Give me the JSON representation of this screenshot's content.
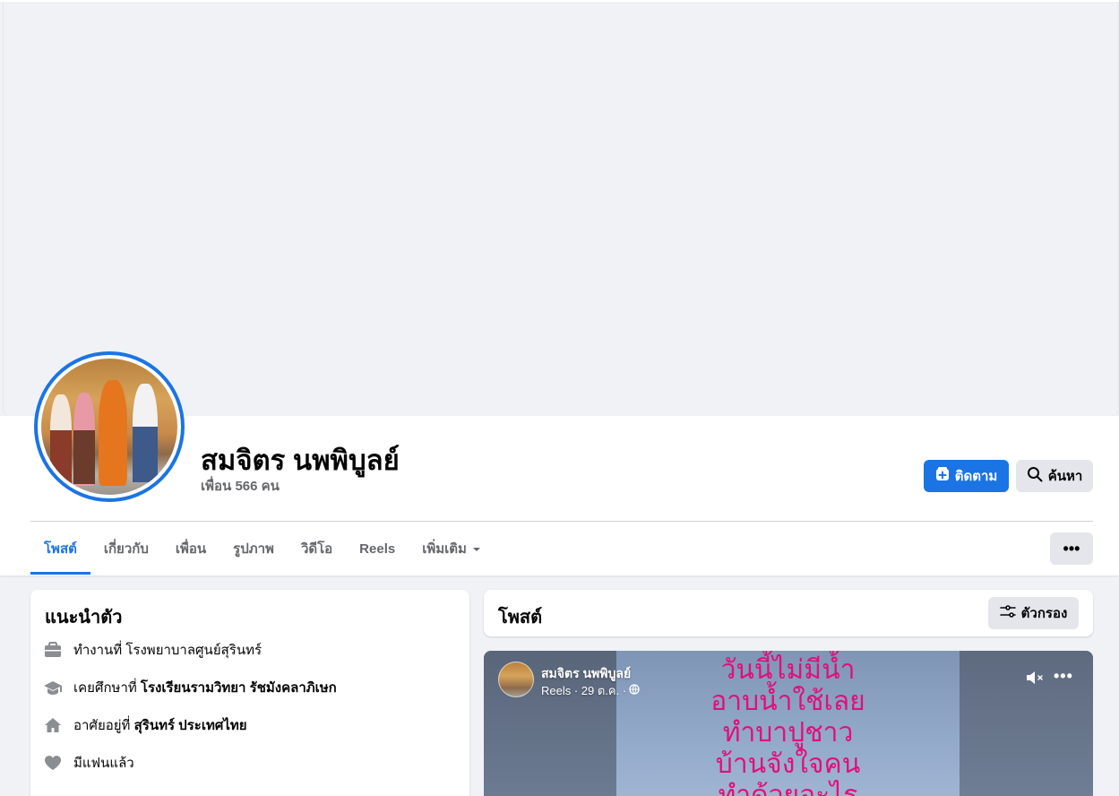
{
  "profile": {
    "name": "สมจิตร นพพิบูลย์",
    "friends_text": "เพื่อน 566 คน"
  },
  "actions": {
    "follow_label": "ติดตาม",
    "search_label": "ค้นหา",
    "more_label": "•••"
  },
  "tabs": [
    {
      "label": "โพสต์",
      "active": true
    },
    {
      "label": "เกี่ยวกับ"
    },
    {
      "label": "เพื่อน"
    },
    {
      "label": "รูปภาพ"
    },
    {
      "label": "วิดีโอ"
    },
    {
      "label": "Reels"
    },
    {
      "label": "เพิ่มเติม"
    }
  ],
  "intro": {
    "title": "แนะนำตัว",
    "items": [
      {
        "icon": "briefcase-icon",
        "prefix": "ทำงานที่ โรงพยาบาลศูนย์สุรินทร์",
        "bold": ""
      },
      {
        "icon": "graduation-cap-icon",
        "prefix": "เคยศึกษาที่ ",
        "bold": "โรงเรียนรามวิทยา รัชมังคลาภิเษก"
      },
      {
        "icon": "home-icon",
        "prefix": "อาศัยอยู่ที่ ",
        "bold": "สุรินทร์ ประเทศไทย"
      },
      {
        "icon": "heart-icon",
        "prefix": "มีแฟนแล้ว",
        "bold": ""
      }
    ]
  },
  "posts": {
    "title": "โพสต์",
    "filter_label": "ตัวกรอง"
  },
  "reel": {
    "author": "สมจิตร นพพิบูลย์",
    "meta": "Reels · 29 ต.ค. ·",
    "caption_lines": [
      "วันนี้ไม่มีน้ำ",
      "อาบน้ำใช้เลย",
      "ทำบาปูชาว",
      "บ้านจังใจคน",
      "ทำด้วยอะไร"
    ]
  },
  "colors": {
    "accent": "#1b74e4",
    "caption": "#e0107a"
  }
}
